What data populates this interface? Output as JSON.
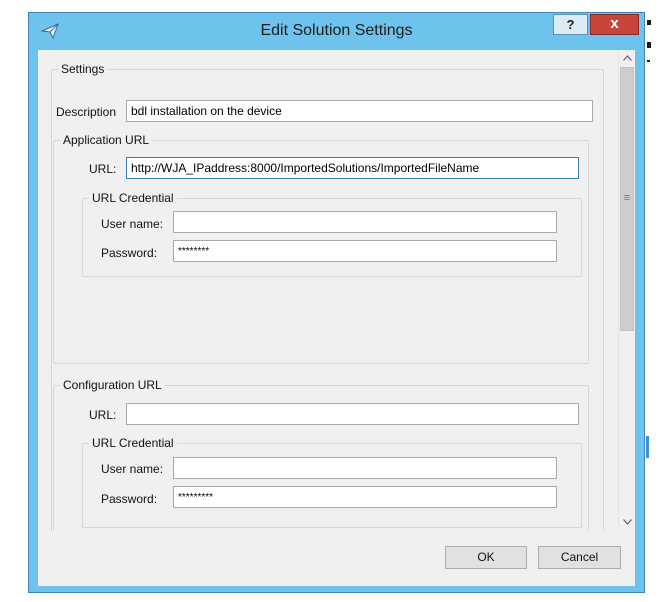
{
  "window": {
    "title": "Edit Solution Settings",
    "help_label": "?",
    "close_label": "x"
  },
  "settings": {
    "group_label": "Settings",
    "description_label": "Description",
    "description_value": "bdl installation on the device"
  },
  "application_url": {
    "group_label": "Application URL",
    "url_label": "URL:",
    "url_value": "http://WJA_IPaddress:8000/ImportedSolutions/ImportedFileName",
    "credential": {
      "group_label": "URL Credential",
      "username_label": "User name:",
      "username_value": "",
      "password_label": "Password:",
      "password_value": "********"
    }
  },
  "configuration_url": {
    "group_label": "Configuration URL",
    "url_label": "URL:",
    "url_value": "",
    "credential": {
      "group_label": "URL Credential",
      "username_label": "User name:",
      "username_value": "",
      "password_label": "Password:",
      "password_value": "*********"
    }
  },
  "scrollbar": {
    "up_icon": "chevron-up-icon",
    "down_icon": "chevron-down-icon",
    "grip": "≡"
  },
  "buttons": {
    "ok_label": "OK",
    "cancel_label": "Cancel"
  },
  "colors": {
    "titlebar": "#6ec3ec",
    "close_button": "#c7463c",
    "dialog_face": "#f0f0f0",
    "focus_border": "#3c7fb1"
  }
}
